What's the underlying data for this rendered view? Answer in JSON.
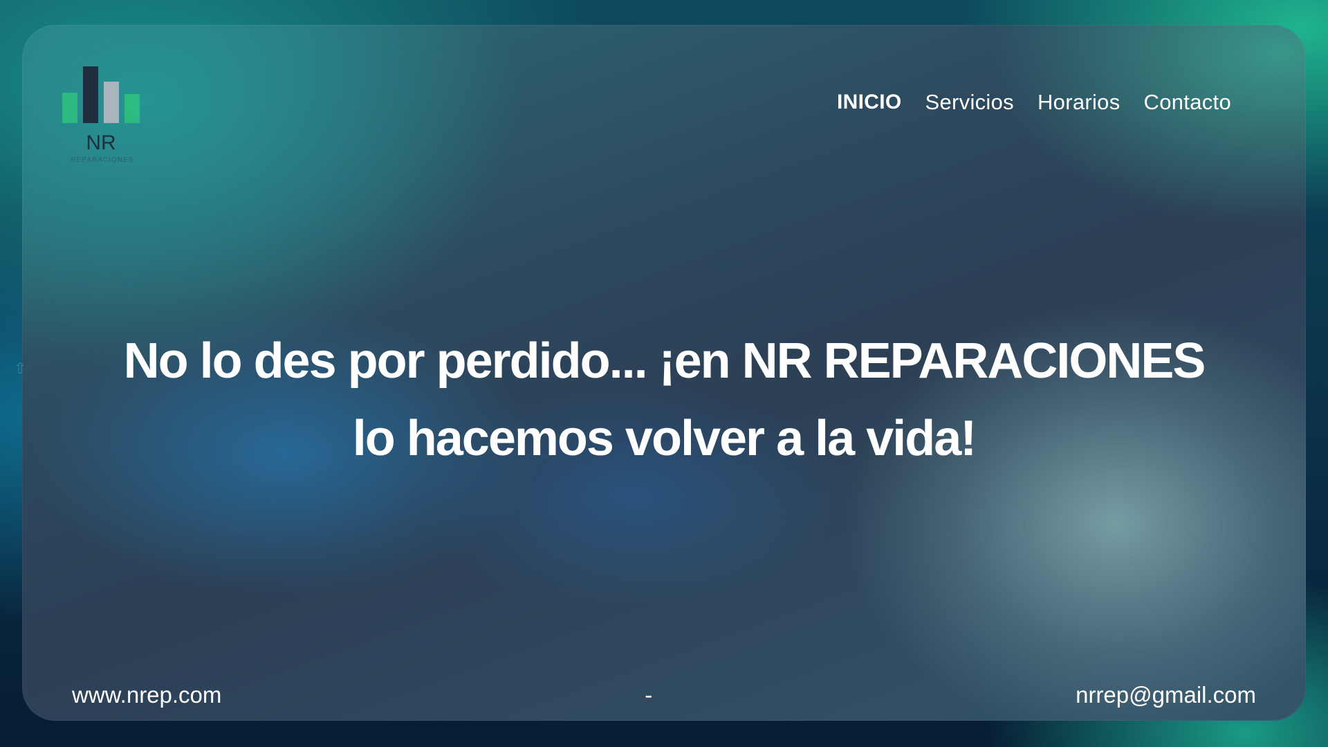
{
  "logo": {
    "letters": "NR",
    "tagline": "REPARACIONES",
    "colors": {
      "green": "#2ec27e",
      "dark": "#1f2f3f",
      "gray": "#a9b4bd"
    }
  },
  "nav": {
    "items": [
      {
        "label": "INICIO",
        "active": true
      },
      {
        "label": "Servicios",
        "active": false
      },
      {
        "label": "Horarios",
        "active": false
      },
      {
        "label": "Contacto",
        "active": false
      }
    ]
  },
  "hero": {
    "line1": "No lo des por perdido... ¡en NR REPARACIONES",
    "line2": "lo hacemos volver a la vida!"
  },
  "footer": {
    "website": "www.nrep.com",
    "separator": "-",
    "email": "nrrep@gmail.com"
  },
  "icons": {
    "scroll": "arrow-up-icon"
  }
}
